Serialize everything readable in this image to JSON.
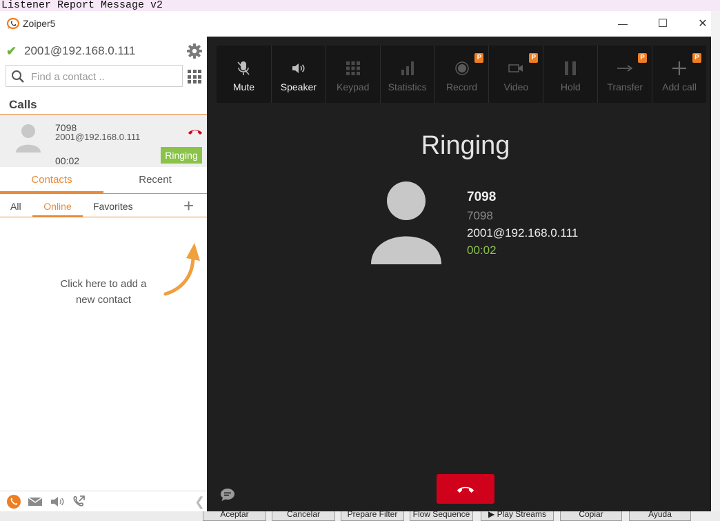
{
  "background_app": {
    "title_text": "Listener Report Message v2",
    "buttons": [
      "Aceptar",
      "Cancelar",
      "Prepare Filter",
      "Flow Sequence",
      "▶ Play Streams",
      "Copiar",
      "Ayuda"
    ]
  },
  "window": {
    "title": "Zoiper5",
    "controls": {
      "minimize": "—",
      "maximize": "☐",
      "close": "✕"
    }
  },
  "sidebar": {
    "account": "2001@192.168.0.111",
    "account_status": "registered",
    "search_placeholder": "Find a contact ..",
    "calls_header": "Calls",
    "active_call": {
      "name": "7098",
      "address": "2001@192.168.0.111",
      "duration": "00:02",
      "status": "Ringing"
    },
    "tabs": [
      {
        "label": "Contacts",
        "active": true
      },
      {
        "label": "Recent",
        "active": false
      }
    ],
    "subtabs": [
      {
        "label": "All",
        "active": false
      },
      {
        "label": "Online",
        "active": true
      },
      {
        "label": "Favorites",
        "active": false
      }
    ],
    "empty_hint_line1": "Click here to add a",
    "empty_hint_line2": "new contact",
    "footer_icons": [
      "phone-icon",
      "mail-icon",
      "speaker-icon",
      "call-forward-icon"
    ]
  },
  "call_panel": {
    "toolbar": [
      {
        "label": "Mute",
        "icon": "microphone-mute-icon",
        "enabled": true,
        "premium": false
      },
      {
        "label": "Speaker",
        "icon": "speaker-icon",
        "enabled": true,
        "premium": false
      },
      {
        "label": "Keypad",
        "icon": "keypad-icon",
        "enabled": false,
        "premium": false
      },
      {
        "label": "Statistics",
        "icon": "statistics-icon",
        "enabled": false,
        "premium": false
      },
      {
        "label": "Record",
        "icon": "record-icon",
        "enabled": false,
        "premium": true
      },
      {
        "label": "Video",
        "icon": "video-icon",
        "enabled": false,
        "premium": true
      },
      {
        "label": "Hold",
        "icon": "pause-icon",
        "enabled": false,
        "premium": false
      },
      {
        "label": "Transfer",
        "icon": "transfer-icon",
        "enabled": false,
        "premium": true
      },
      {
        "label": "Add call",
        "icon": "plus-icon",
        "enabled": false,
        "premium": true
      }
    ],
    "premium_badge": "P",
    "state": "Ringing",
    "peer_name": "7098",
    "peer_number": "7098",
    "peer_account": "2001@192.168.0.111",
    "duration": "00:02"
  },
  "colors": {
    "accent": "#e98a3a",
    "ringing_badge": "#8bc34a",
    "duration_text": "#8bc34a",
    "hangup": "#d0021b",
    "premium_badge": "#ef7d22",
    "call_panel_bg": "#1f1f1f"
  }
}
